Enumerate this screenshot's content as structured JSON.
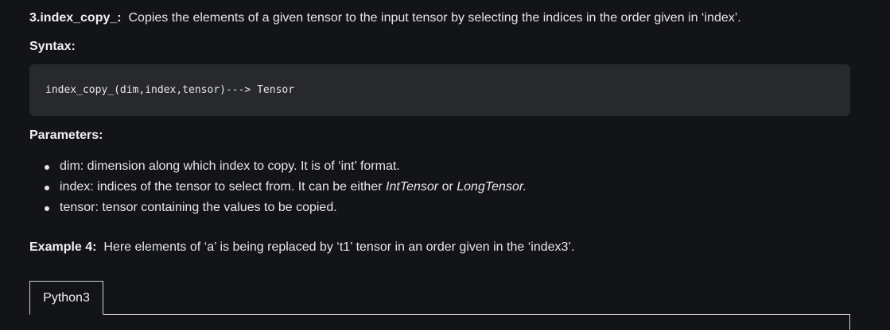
{
  "section": {
    "title": "3.index_copy_:",
    "description": "Copies the elements of a given tensor to the input tensor by selecting the indices in the order given in ‘index’."
  },
  "syntax": {
    "label": "Syntax:",
    "code": "index_copy_(dim,index,tensor)---> Tensor"
  },
  "parameters": {
    "label": "Parameters:",
    "items": [
      {
        "text": "dim: dimension along which index to copy. It is of ‘int’ format."
      },
      {
        "prefix": "index: indices of the tensor to select from. It can be either ",
        "italic1": "IntTensor",
        "middle": " or ",
        "italic2": "LongTensor."
      },
      {
        "text": "tensor: tensor containing the values to be copied."
      }
    ]
  },
  "example": {
    "label": "Example 4:",
    "text": "Here elements of ‘a’ is being replaced by ‘t1’ tensor in an order given in the ‘index3’."
  },
  "code_tabs": {
    "active": "Python3"
  }
}
